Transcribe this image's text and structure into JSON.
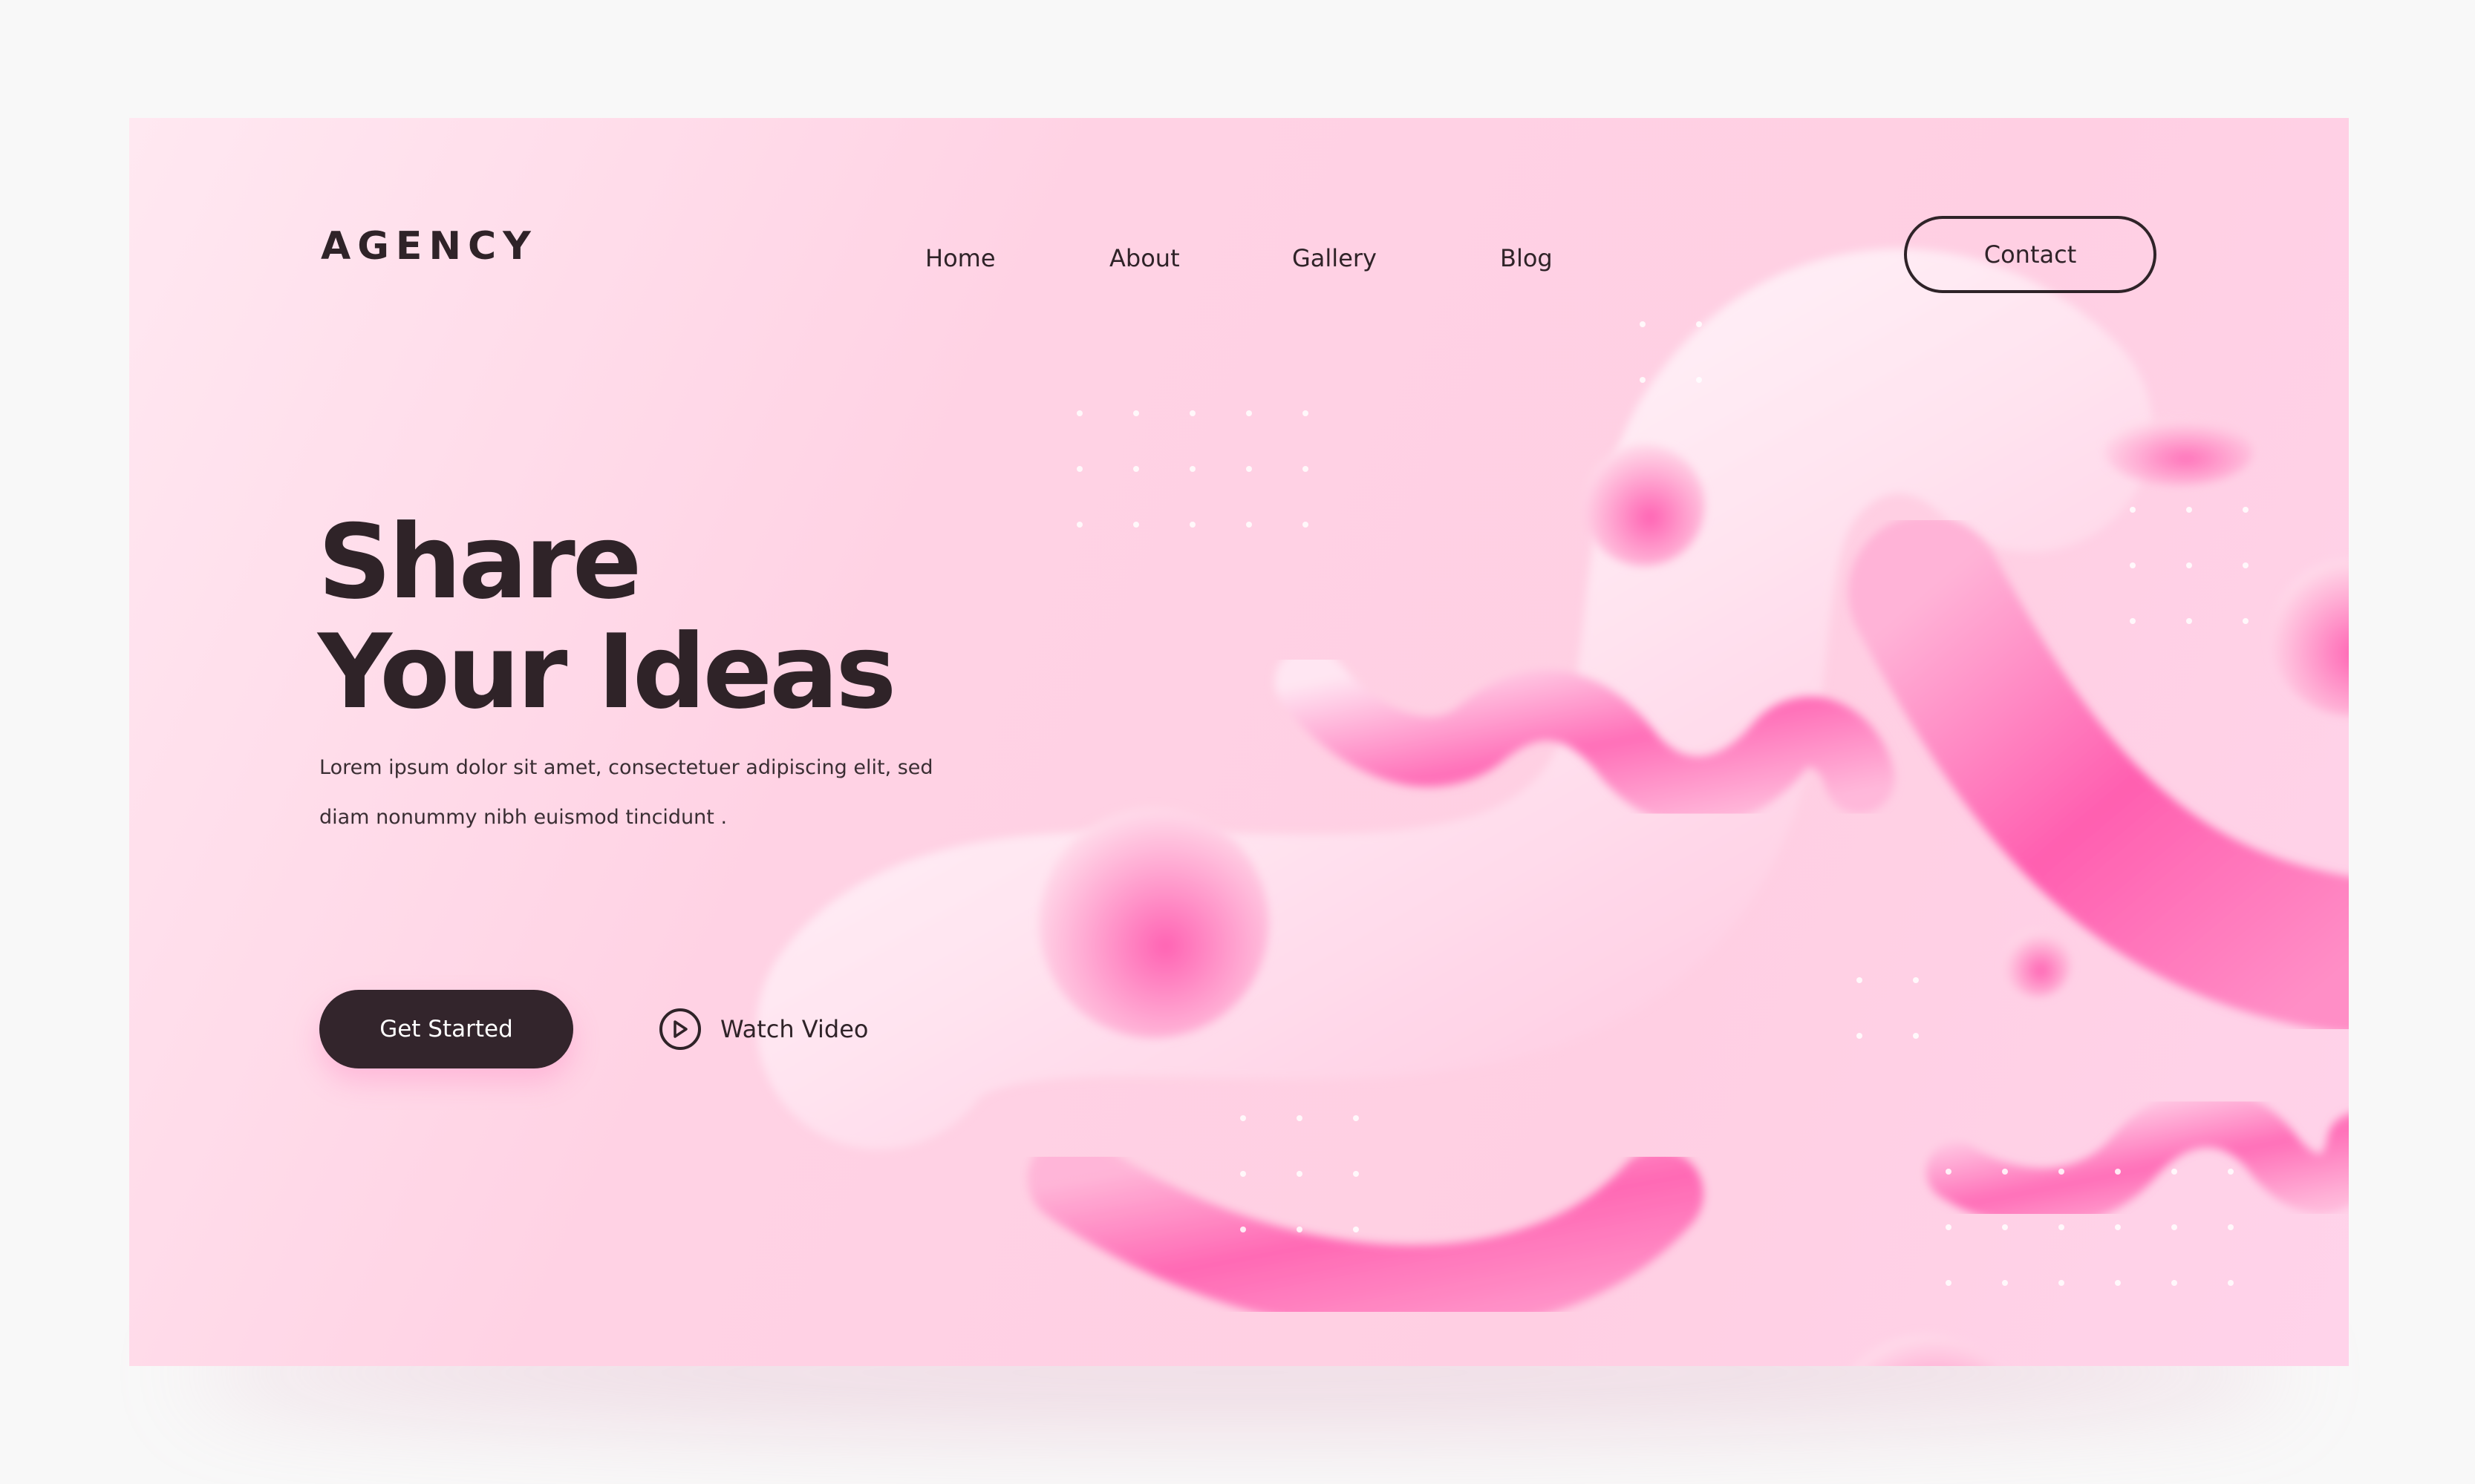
{
  "header": {
    "logo": "AGENCY",
    "nav": [
      "Home",
      "About",
      "Gallery",
      "Blog"
    ],
    "contact_label": "Contact"
  },
  "hero": {
    "title_line1": "Share",
    "title_line2": "Your Ideas",
    "description_line1": "Lorem ipsum dolor sit amet, consectetuer adipiscing elit, sed",
    "description_line2": "diam nonummy nibh euismod tincidunt .",
    "primary_cta": "Get Started",
    "secondary_cta": "Watch Video"
  },
  "icons": {
    "play": "play-icon"
  },
  "colors": {
    "page_background": "#f8f8f8",
    "card_background": "#ffd2e4",
    "text_dark": "#2f2328",
    "button_dark": "#33252c",
    "accent_pink": "#ff5fb0"
  }
}
